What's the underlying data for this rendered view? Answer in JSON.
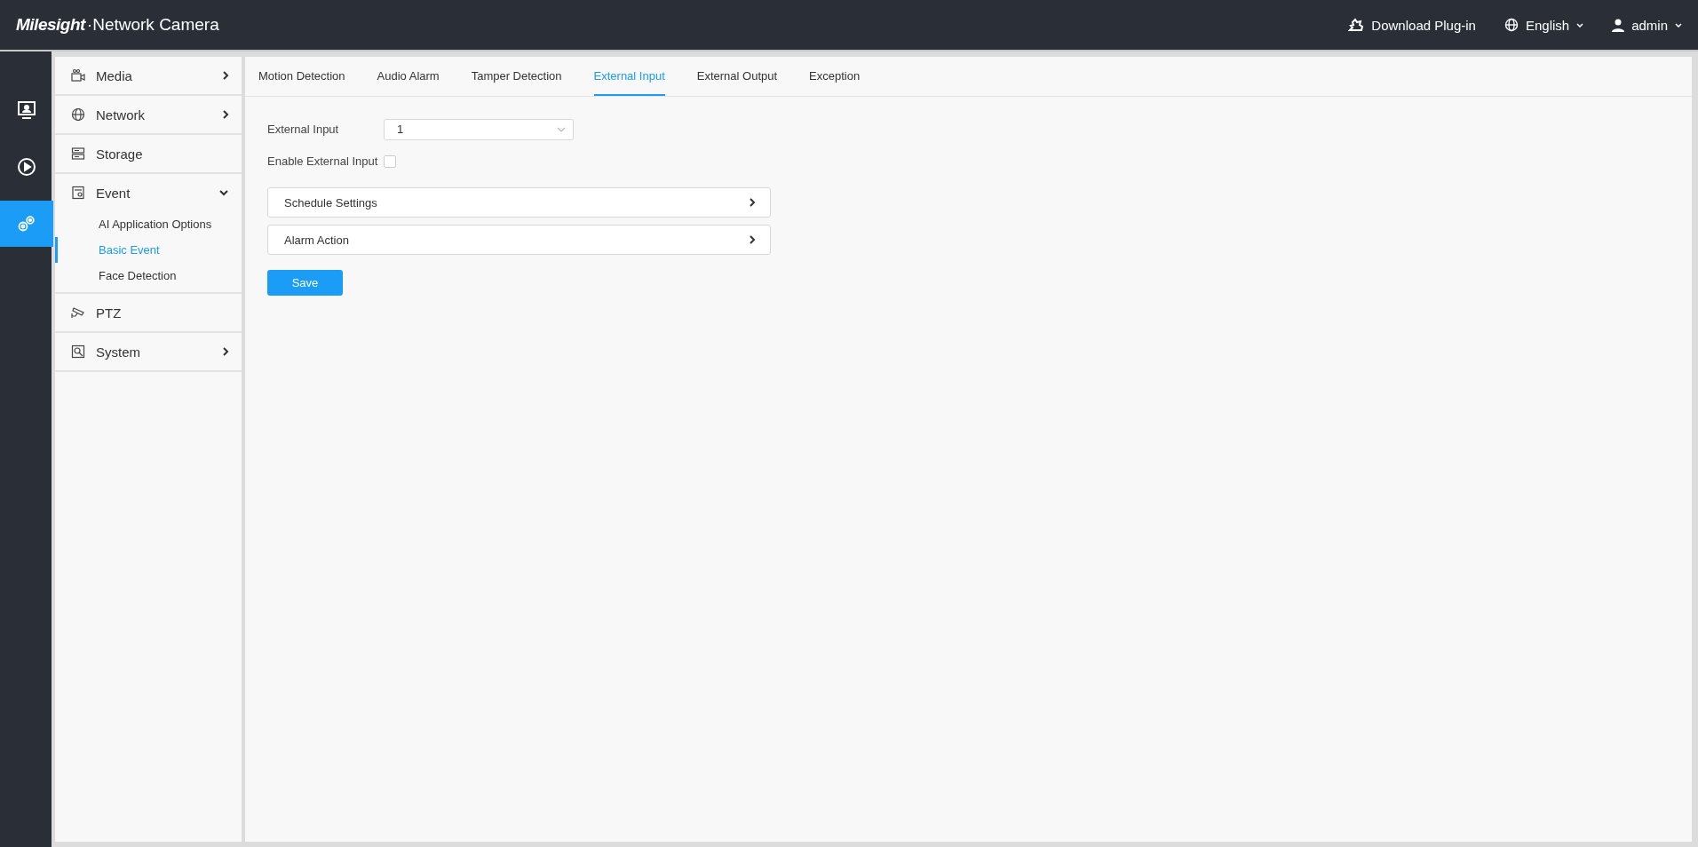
{
  "header": {
    "brand": "Milesight",
    "product": "·Network Camera",
    "download": "Download Plug-in",
    "language": "English",
    "user": "admin"
  },
  "rail": [
    {
      "kind": "live",
      "selected": false
    },
    {
      "kind": "playback",
      "selected": false
    },
    {
      "kind": "settings",
      "selected": true
    }
  ],
  "menu": [
    {
      "kind": "media",
      "label": "Media",
      "has_submenu": true,
      "expanded": false
    },
    {
      "kind": "network",
      "label": "Network",
      "has_submenu": true,
      "expanded": false
    },
    {
      "kind": "storage",
      "label": "Storage",
      "has_submenu": false
    },
    {
      "kind": "event",
      "label": "Event",
      "has_submenu": true,
      "expanded": true,
      "children": [
        {
          "label": "AI Application Options",
          "selected": false
        },
        {
          "label": "Basic Event",
          "selected": true
        },
        {
          "label": "Face Detection",
          "selected": false
        }
      ]
    },
    {
      "kind": "ptz",
      "label": "PTZ",
      "has_submenu": false
    },
    {
      "kind": "system",
      "label": "System",
      "has_submenu": true,
      "expanded": false
    }
  ],
  "tabs": [
    {
      "label": "Motion Detection",
      "selected": false
    },
    {
      "label": "Audio Alarm",
      "selected": false
    },
    {
      "label": "Tamper Detection",
      "selected": false
    },
    {
      "label": "External Input",
      "selected": true
    },
    {
      "label": "External Output",
      "selected": false
    },
    {
      "label": "Exception",
      "selected": false
    }
  ],
  "form": {
    "input_label": "External Input",
    "input_value": "1",
    "enable_label": "Enable External Input",
    "enable_checked": false
  },
  "sections": [
    "Schedule Settings",
    "Alarm Action"
  ],
  "save": "Save"
}
